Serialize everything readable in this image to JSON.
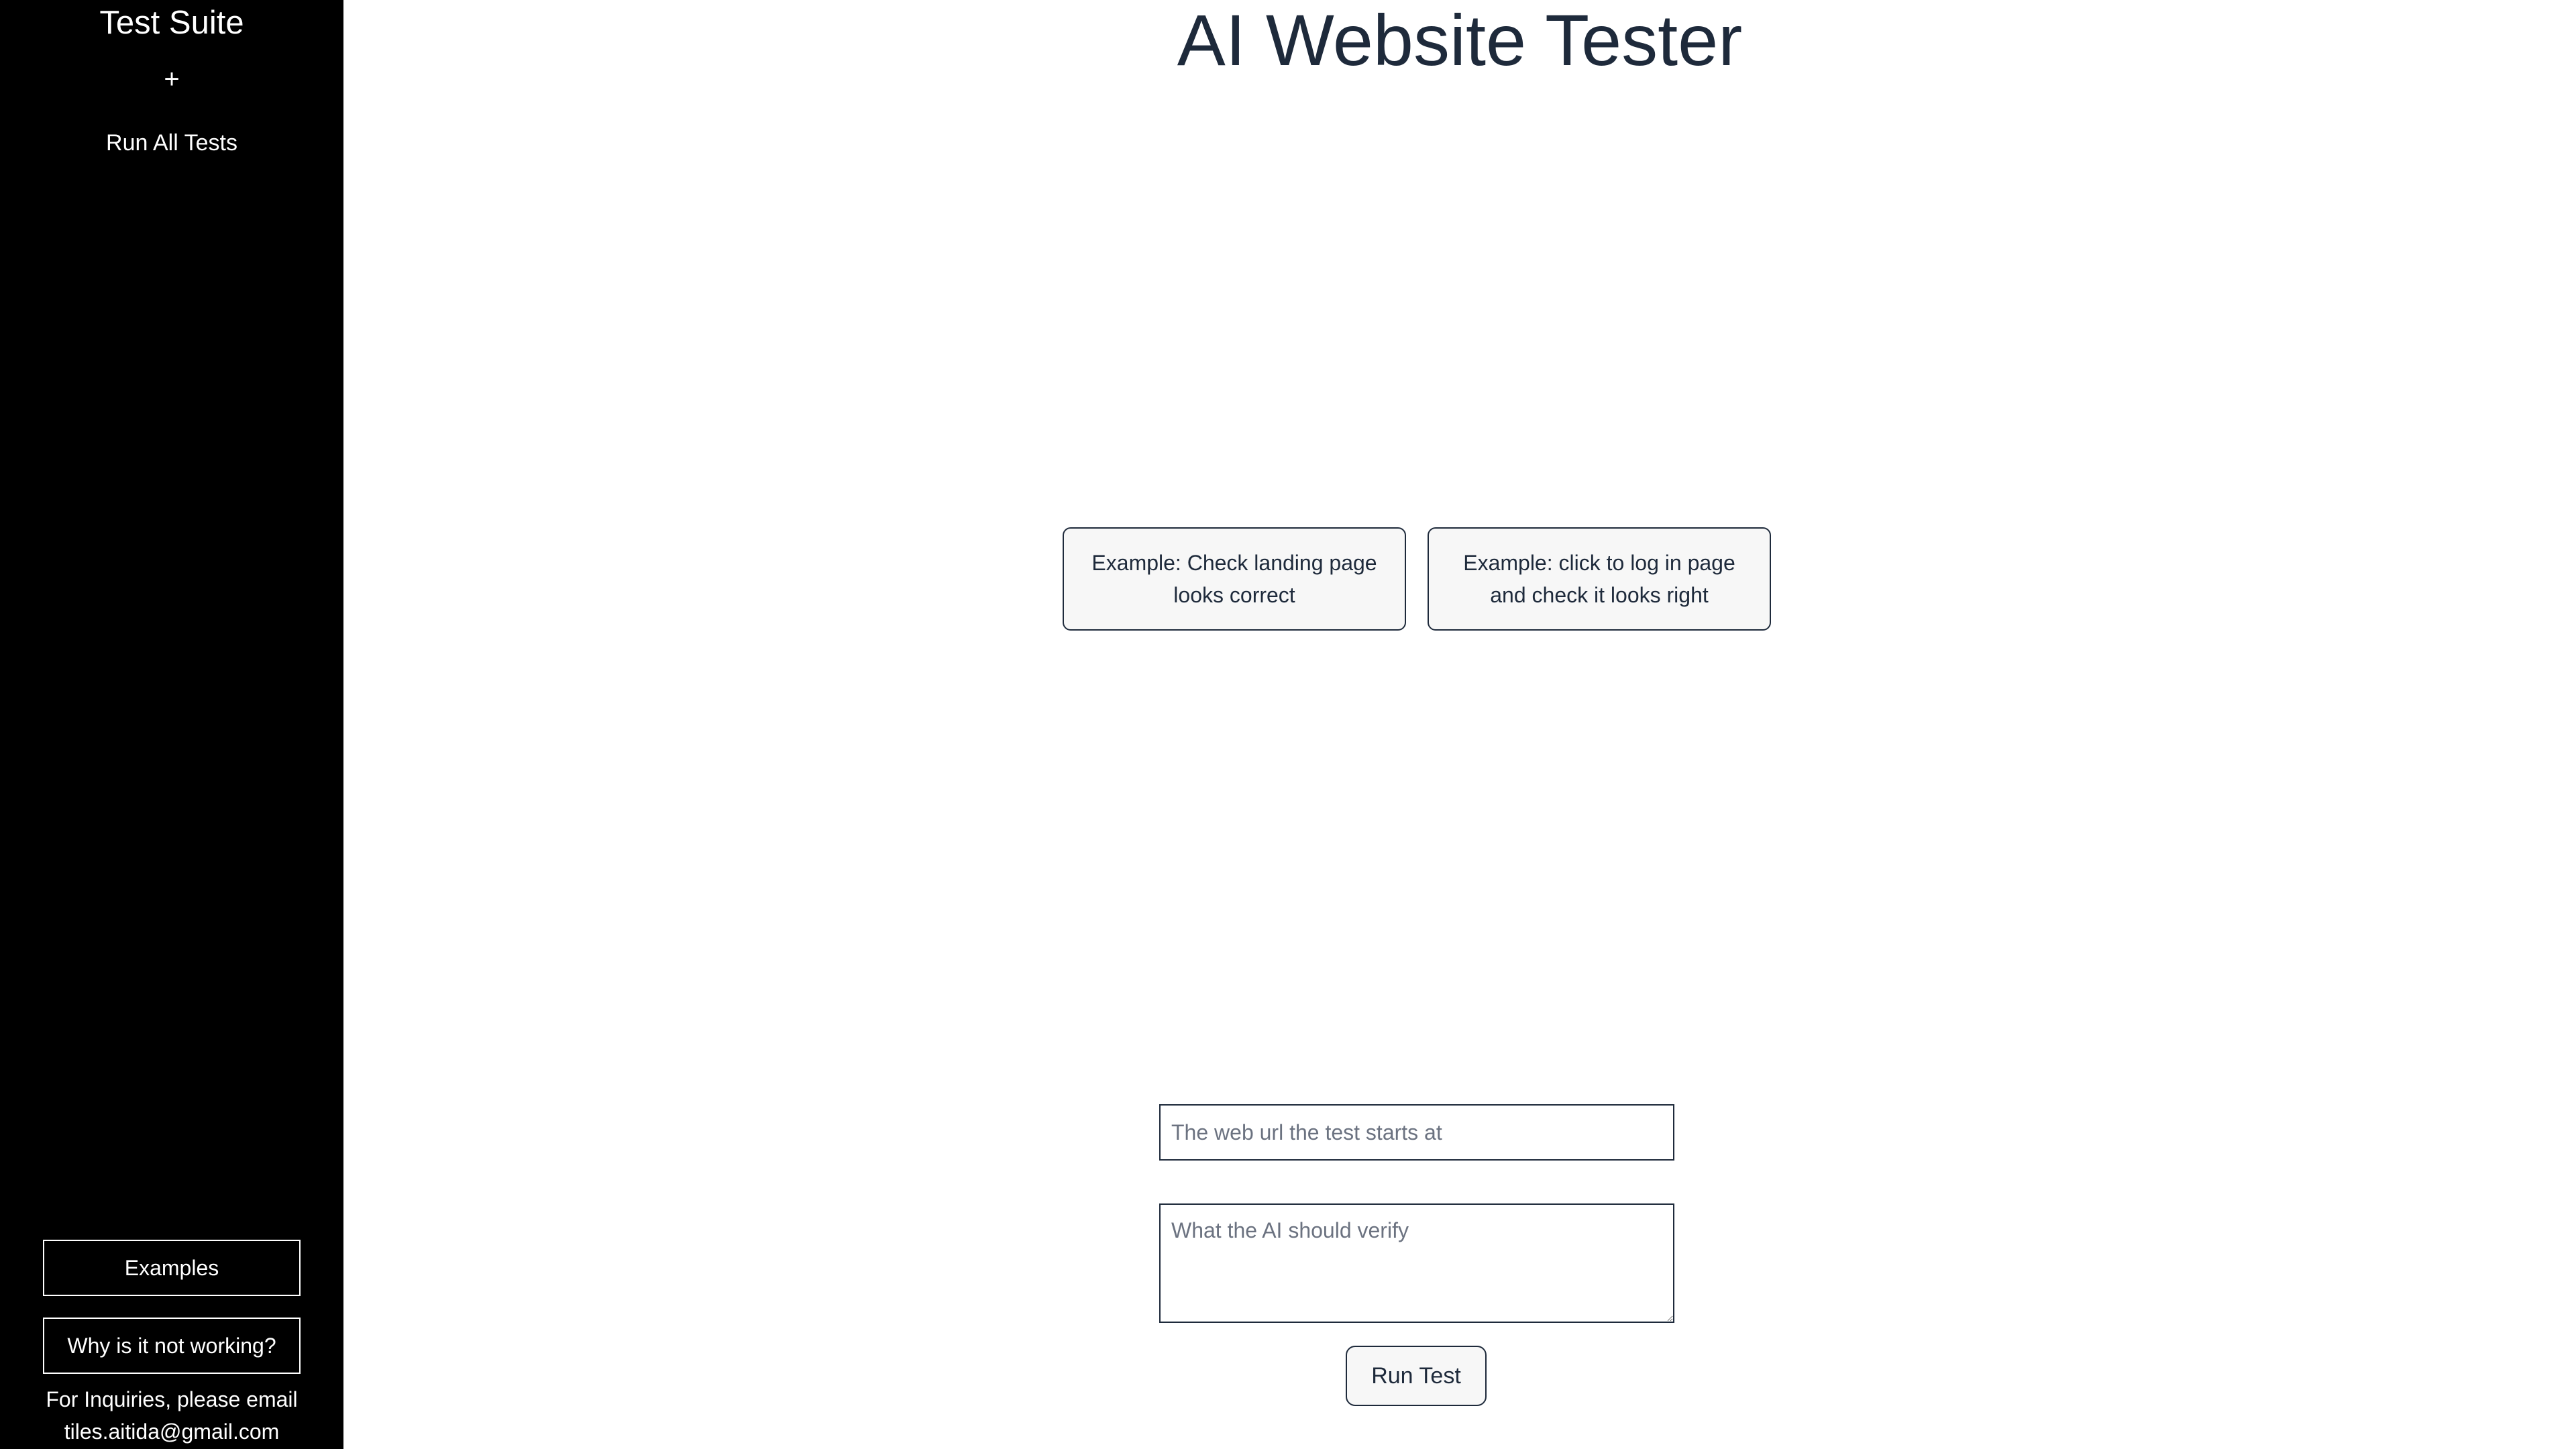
{
  "sidebar": {
    "title": "Test Suite",
    "add_label": "+",
    "run_all_label": "Run All Tests",
    "examples_label": "Examples",
    "why_label": "Why is it not working?",
    "footer_line1": "For Inquiries, please email",
    "footer_line2": "tiles.aitida@gmail.com"
  },
  "main": {
    "title": "AI Website Tester",
    "examples": [
      {
        "label": "Example: Check landing page looks correct"
      },
      {
        "label": "Example: click to log in page and check it looks right"
      }
    ],
    "url_placeholder": "The web url the test starts at",
    "verify_placeholder": "What the AI should verify",
    "run_test_label": "Run Test"
  },
  "colors": {
    "sidebar_bg": "#000000",
    "text_dark": "#1e2a3b",
    "card_bg": "#f7f7f7"
  }
}
